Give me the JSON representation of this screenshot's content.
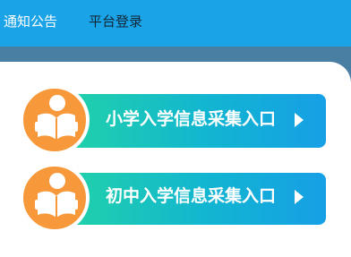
{
  "nav": {
    "items": [
      {
        "label": "通知公告",
        "active": true
      },
      {
        "label": "平台登录",
        "active": false
      }
    ]
  },
  "entries": [
    {
      "label": "小学入学信息采集入口",
      "icon": "reading-student-icon",
      "arrow": "play-arrow-icon"
    },
    {
      "label": "初中入学信息采集入口",
      "icon": "reading-student-icon",
      "arrow": "play-arrow-icon"
    }
  ],
  "colors": {
    "topbar": "#1aa3e6",
    "band": "#4a7fa4",
    "icon_circle": "#f7983a",
    "entry_gradient_start": "#22d4a6",
    "entry_gradient_end": "#169fe6"
  }
}
